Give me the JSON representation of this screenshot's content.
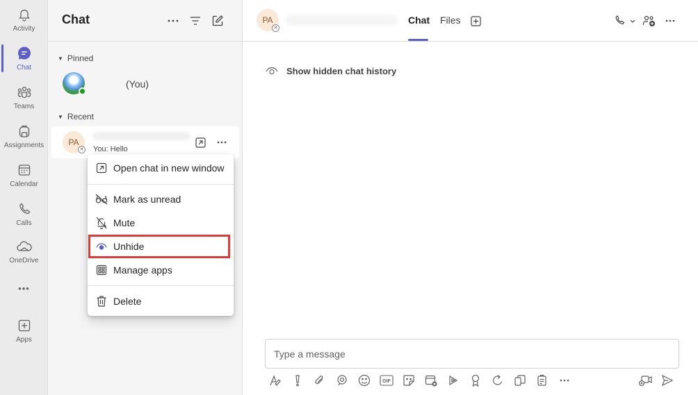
{
  "rail": {
    "items": [
      {
        "label": "Activity",
        "icon": "bell-icon"
      },
      {
        "label": "Chat",
        "icon": "chat-icon"
      },
      {
        "label": "Teams",
        "icon": "teams-icon"
      },
      {
        "label": "Assignments",
        "icon": "backpack-icon"
      },
      {
        "label": "Calendar",
        "icon": "calendar-icon"
      },
      {
        "label": "Calls",
        "icon": "phone-icon"
      },
      {
        "label": "OneDrive",
        "icon": "cloud-icon"
      },
      {
        "label": "Apps",
        "icon": "add-app-icon"
      }
    ],
    "more": "•••",
    "active_color": "#5b5fc7"
  },
  "list": {
    "title": "Chat",
    "pinned_label": "Pinned",
    "recent_label": "Recent",
    "pinned_you": "(You)",
    "recent_avatar": "PA",
    "recent_preview": "You: Hello"
  },
  "menu": {
    "items": [
      {
        "label": "Open chat in new window",
        "icon": "popout-icon"
      },
      {
        "label": "Mark as unread",
        "icon": "glasses-icon"
      },
      {
        "label": "Mute",
        "icon": "bell-off-icon"
      },
      {
        "label": "Unhide",
        "icon": "eye-icon"
      },
      {
        "label": "Manage apps",
        "icon": "apps-grid-icon"
      },
      {
        "label": "Delete",
        "icon": "trash-icon"
      }
    ],
    "highlighted": "Unhide",
    "highlight_color": "#e53935"
  },
  "main": {
    "avatar": "PA",
    "tabs": [
      {
        "label": "Chat",
        "active": true
      },
      {
        "label": "Files",
        "active": false
      }
    ],
    "hidden_history": "Show hidden chat history",
    "compose_placeholder": "Type a message"
  }
}
